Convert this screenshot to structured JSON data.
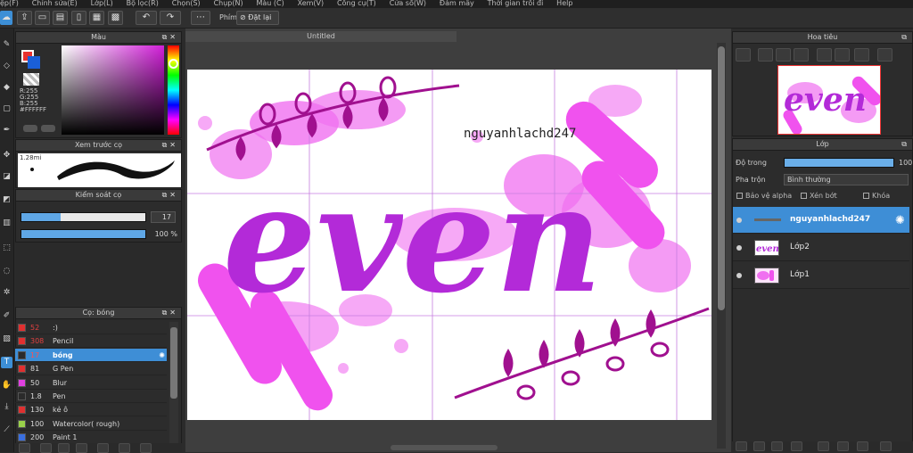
{
  "menu": [
    "ệp(F)",
    "Chỉnh sửa(E)",
    "Lớp(L)",
    "Bộ lọc(R)",
    "Chọn(S)",
    "Chụp(N)",
    "Màu (C)",
    "Xem(V)",
    "Công cụ(T)",
    "Cửa sổ(W)",
    "Đám mây",
    "Thời gian trôi đi",
    "Help"
  ],
  "toolbar": {
    "key_label": "Phím",
    "reset_label": "Đặt lại"
  },
  "document": {
    "tab_title": "Untitled"
  },
  "color_panel": {
    "title": "Màu",
    "r": "R:255",
    "g": "G:255",
    "b": "B:255",
    "hex": "#FFFFFF",
    "fg": "#e8312f",
    "bg": "#1a5fd8",
    "hue_accent": "#d21fd9"
  },
  "brush_preview": {
    "title": "Xem trước cọ",
    "size": "1.28mi"
  },
  "brush_control": {
    "title": "Kiểm soát cọ",
    "size_value": "17",
    "size_fill": 0.32,
    "opacity_value": "100 %",
    "opacity_fill": 1.0
  },
  "brush_list": {
    "title": "Cọ: bóng",
    "items": [
      {
        "size": "52",
        "name": ":)",
        "color": "#e03030",
        "size_color": "#e04040"
      },
      {
        "size": "308",
        "name": "Pencil",
        "color": "#e03030",
        "size_color": "#e04040"
      },
      {
        "size": "17",
        "name": "bóng",
        "color": "#2b2b2b",
        "size_color": "#ff5050",
        "selected": true
      },
      {
        "size": "81",
        "name": "G Pen",
        "color": "#e03030",
        "size_color": "#d9d9d9"
      },
      {
        "size": "50",
        "name": "Blur",
        "color": "#e040e0",
        "size_color": "#d9d9d9"
      },
      {
        "size": "1.8",
        "name": "Pen",
        "color": "#2b2b2b",
        "size_color": "#d9d9d9"
      },
      {
        "size": "130",
        "name": "kẻ ô",
        "color": "#e03030",
        "size_color": "#d9d9d9"
      },
      {
        "size": "100",
        "name": "Watercolor( rough)",
        "color": "#9ad14a",
        "size_color": "#d9d9d9"
      },
      {
        "size": "200",
        "name": "Paint 1",
        "color": "#3a6fe0",
        "size_color": "#d9d9d9"
      }
    ]
  },
  "navigator": {
    "title": "Hoa tiêu"
  },
  "layers_panel": {
    "title": "Lớp",
    "opacity_label": "Độ trong",
    "opacity_value": "100",
    "opacity_fill": 1.0,
    "blend_label": "Pha trộn",
    "blend_value": "Bình thường",
    "protect_alpha": "Bảo vệ alpha",
    "clipping": "Xén bớt",
    "lock": "Khóa",
    "layers": [
      {
        "name": "nguyanhlachd247",
        "selected": true
      },
      {
        "name": "Lớp2",
        "selected": false
      },
      {
        "name": "Lớp1",
        "selected": false
      }
    ]
  },
  "artwork": {
    "word": "even",
    "watermark": "nguyanhlachd247",
    "ink": "#b32ad8",
    "splash": "#f05ef0",
    "leaf": "#a0108f"
  }
}
